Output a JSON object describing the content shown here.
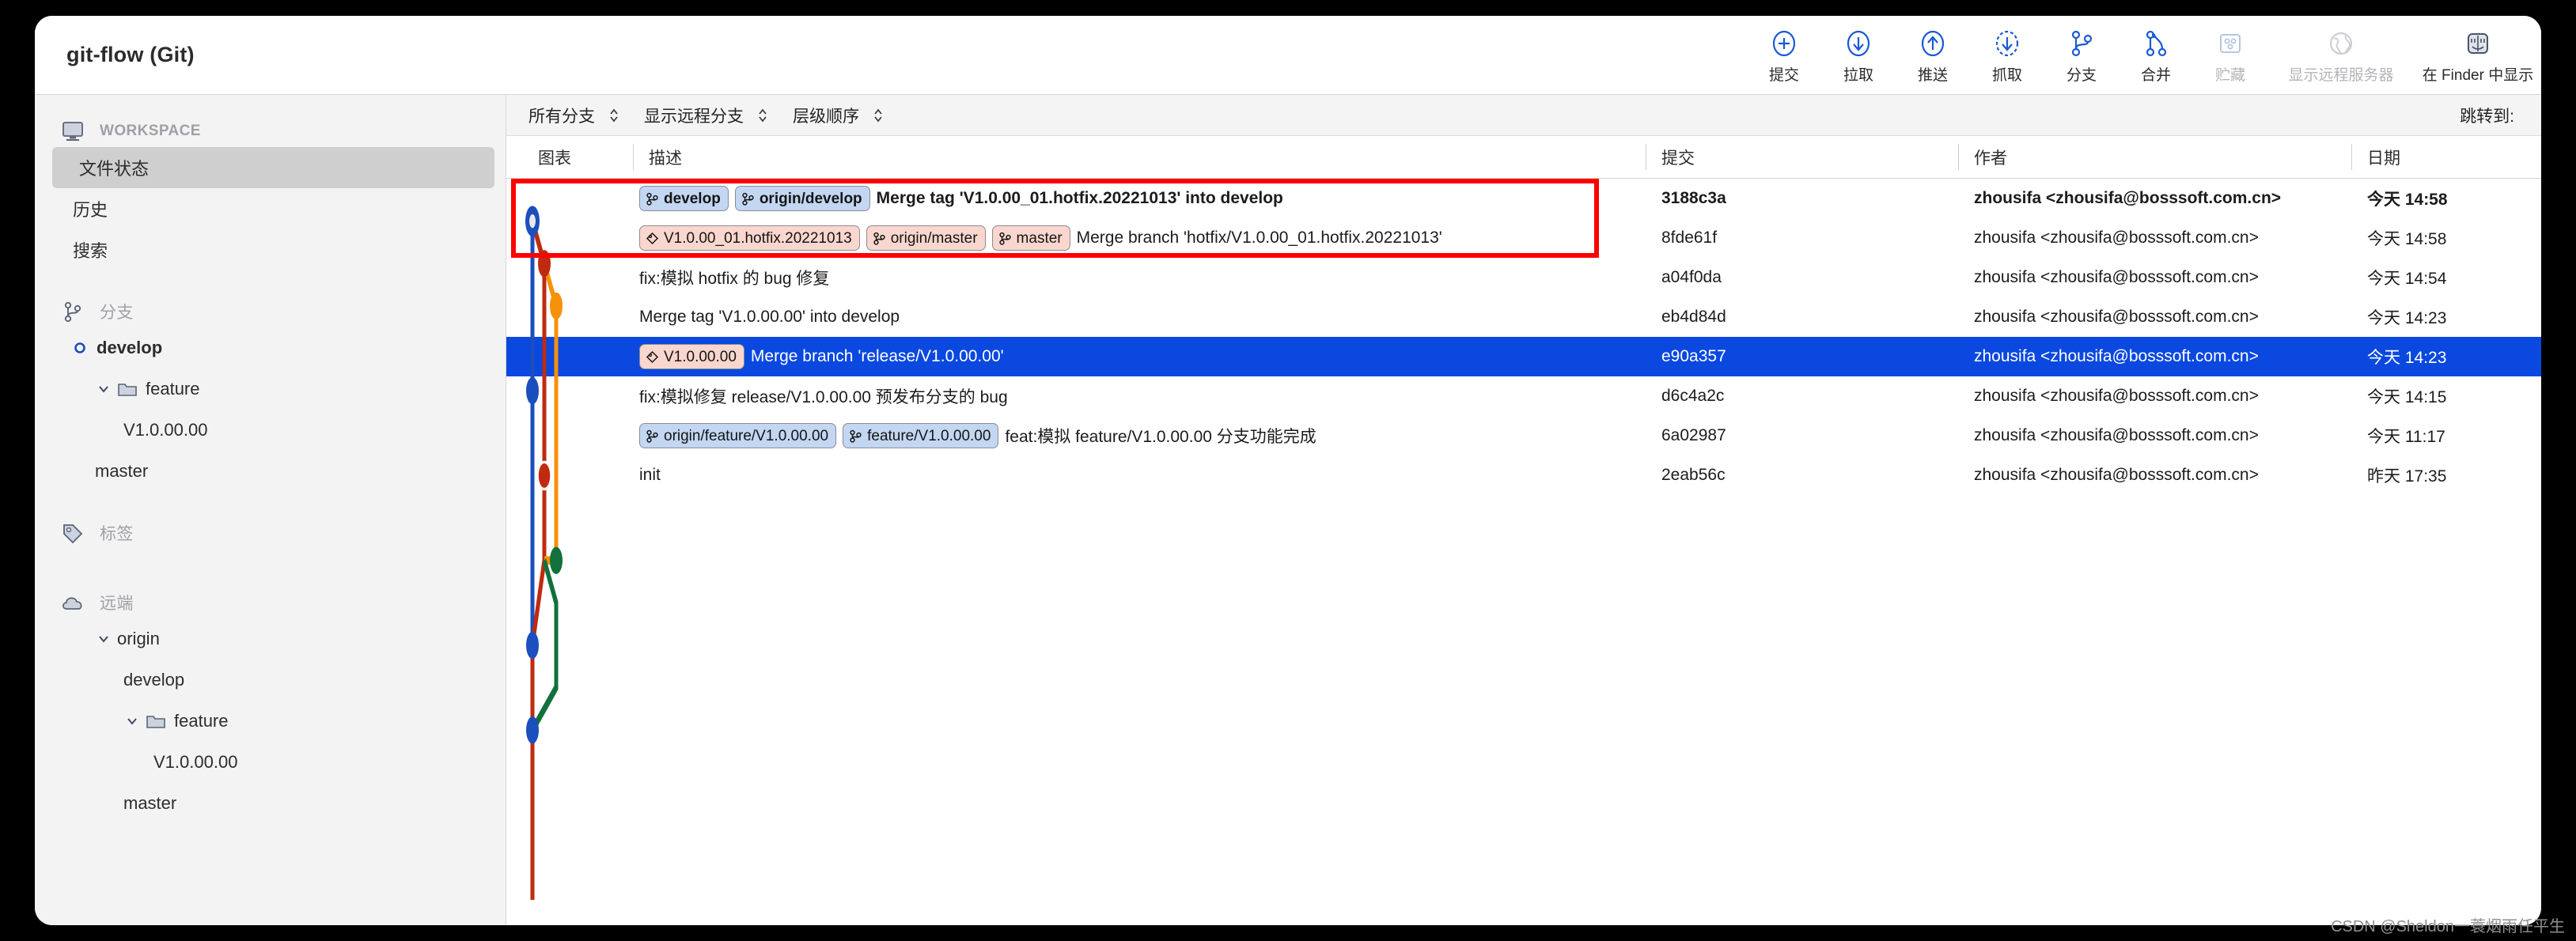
{
  "window": {
    "title": "git-flow (Git)"
  },
  "toolbar": {
    "items": [
      {
        "label": "提交",
        "icon": "commit-plus-icon",
        "disabled": false,
        "width": "normal"
      },
      {
        "label": "拉取",
        "icon": "pull-down-arrow-icon",
        "disabled": false,
        "width": "normal"
      },
      {
        "label": "推送",
        "icon": "push-up-arrow-icon",
        "disabled": false,
        "width": "normal"
      },
      {
        "label": "抓取",
        "icon": "fetch-dashed-icon",
        "disabled": false,
        "width": "normal"
      },
      {
        "label": "分支",
        "icon": "branch-icon",
        "disabled": false,
        "width": "normal"
      },
      {
        "label": "合并",
        "icon": "merge-icon",
        "disabled": false,
        "width": "normal"
      },
      {
        "label": "贮藏",
        "icon": "stash-box-icon",
        "disabled": true,
        "width": "normal"
      },
      {
        "label": "显示远程服务器",
        "icon": "globe-icon",
        "disabled": true,
        "width": "wide"
      },
      {
        "label": "在 Finder 中显示",
        "icon": "finder-icon",
        "disabled": false,
        "width": "wide"
      }
    ]
  },
  "sidebar": {
    "sections": [
      {
        "icon": "monitor-icon",
        "label": "WORKSPACE",
        "style": "caps"
      },
      {
        "icon": "branch-icon",
        "label": "分支",
        "style": "cn"
      },
      {
        "icon": "tag-icon",
        "label": "标签",
        "style": "cn"
      },
      {
        "icon": "cloud-icon",
        "label": "远端",
        "style": "cn"
      }
    ],
    "workspace_items": [
      {
        "label": "文件状态",
        "selected": true
      },
      {
        "label": "历史",
        "selected": false
      },
      {
        "label": "搜索",
        "selected": false
      }
    ],
    "branches": [
      {
        "label": "develop",
        "type": "current-branch",
        "indent": 1
      },
      {
        "label": "feature",
        "type": "folder",
        "indent": 1
      },
      {
        "label": "V1.0.00.00",
        "type": "leaf",
        "indent": 3
      },
      {
        "label": "master",
        "type": "leaf",
        "indent": 2
      }
    ],
    "remotes": [
      {
        "label": "origin",
        "type": "remote",
        "indent": 1
      },
      {
        "label": "develop",
        "type": "leaf",
        "indent": 2
      },
      {
        "label": "feature",
        "type": "folder",
        "indent": 2
      },
      {
        "label": "V1.0.00.00",
        "type": "leaf",
        "indent": 4
      },
      {
        "label": "master",
        "type": "leaf",
        "indent": 3
      }
    ]
  },
  "filterbar": {
    "filters": [
      {
        "label": "所有分支"
      },
      {
        "label": "显示远程分支"
      },
      {
        "label": "层级顺序"
      }
    ],
    "jump_to_label": "跳转到:"
  },
  "table": {
    "columns": [
      {
        "label": "图表"
      },
      {
        "label": "描述"
      },
      {
        "label": "提交"
      },
      {
        "label": "作者"
      },
      {
        "label": "日期"
      }
    ],
    "rows": [
      {
        "badges": [
          {
            "text": "develop",
            "kind": "branch",
            "color": "blue"
          },
          {
            "text": "origin/develop",
            "kind": "branch",
            "color": "blue"
          }
        ],
        "message": "Merge tag 'V1.0.00_01.hotfix.20221013' into develop",
        "hash": "3188c3a",
        "author": "zhousifa <zhousifa@bosssoft.com.cn>",
        "date": "今天 14:58",
        "bold": true,
        "selected": false
      },
      {
        "badges": [
          {
            "text": "V1.0.00_01.hotfix.20221013",
            "kind": "tag",
            "color": "pink"
          },
          {
            "text": "origin/master",
            "kind": "branch",
            "color": "pink"
          },
          {
            "text": "master",
            "kind": "branch",
            "color": "pink"
          }
        ],
        "message": "Merge branch 'hotfix/V1.0.00_01.hotfix.20221013'",
        "hash": "8fde61f",
        "author": "zhousifa <zhousifa@bosssoft.com.cn>",
        "date": "今天 14:58",
        "bold": false,
        "selected": false
      },
      {
        "badges": [],
        "message": "fix:模拟 hotfix 的 bug 修复",
        "hash": "a04f0da",
        "author": "zhousifa <zhousifa@bosssoft.com.cn>",
        "date": "今天 14:54",
        "bold": false,
        "selected": false
      },
      {
        "badges": [],
        "message": "Merge tag 'V1.0.00.00' into develop",
        "hash": "eb4d84d",
        "author": "zhousifa <zhousifa@bosssoft.com.cn>",
        "date": "今天 14:23",
        "bold": false,
        "selected": false
      },
      {
        "badges": [
          {
            "text": "V1.0.00.00",
            "kind": "tag",
            "color": "pink"
          }
        ],
        "message": "Merge branch 'release/V1.0.00.00'",
        "hash": "e90a357",
        "author": "zhousifa <zhousifa@bosssoft.com.cn>",
        "date": "今天 14:23",
        "bold": false,
        "selected": true
      },
      {
        "badges": [],
        "message": "fix:模拟修复 release/V1.0.00.00 预发布分支的 bug",
        "hash": "d6c4a2c",
        "author": "zhousifa <zhousifa@bosssoft.com.cn>",
        "date": "今天 14:15",
        "bold": false,
        "selected": false
      },
      {
        "badges": [
          {
            "text": "origin/feature/V1.0.00.00",
            "kind": "branch",
            "color": "blue"
          },
          {
            "text": "feature/V1.0.00.00",
            "kind": "branch",
            "color": "blue"
          }
        ],
        "message": "feat:模拟 feature/V1.0.00.00 分支功能完成",
        "hash": "6a02987",
        "author": "zhousifa <zhousifa@bosssoft.com.cn>",
        "date": "今天 11:17",
        "bold": false,
        "selected": false
      },
      {
        "badges": [],
        "message": "init",
        "hash": "2eab56c",
        "author": "zhousifa <zhousifa@bosssoft.com.cn>",
        "date": "昨天 17:35",
        "bold": false,
        "selected": false
      }
    ]
  },
  "annotation": {
    "highlight_color": "#ff0000",
    "selection_color": "#0a48e0"
  },
  "watermark": {
    "text": "CSDN @Sheldon一蓑烟雨任平生"
  }
}
